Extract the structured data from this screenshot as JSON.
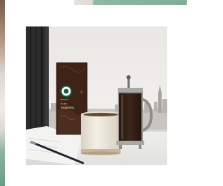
{
  "product": {
    "brand": "STARBUCKS",
    "roast_label": "DARK",
    "name": "VERONA"
  },
  "colors": {
    "bag": "#3e2416",
    "bag_stripe": "#1b5a40",
    "mug": "#ece7dc",
    "accent_green": "#7fae96"
  }
}
